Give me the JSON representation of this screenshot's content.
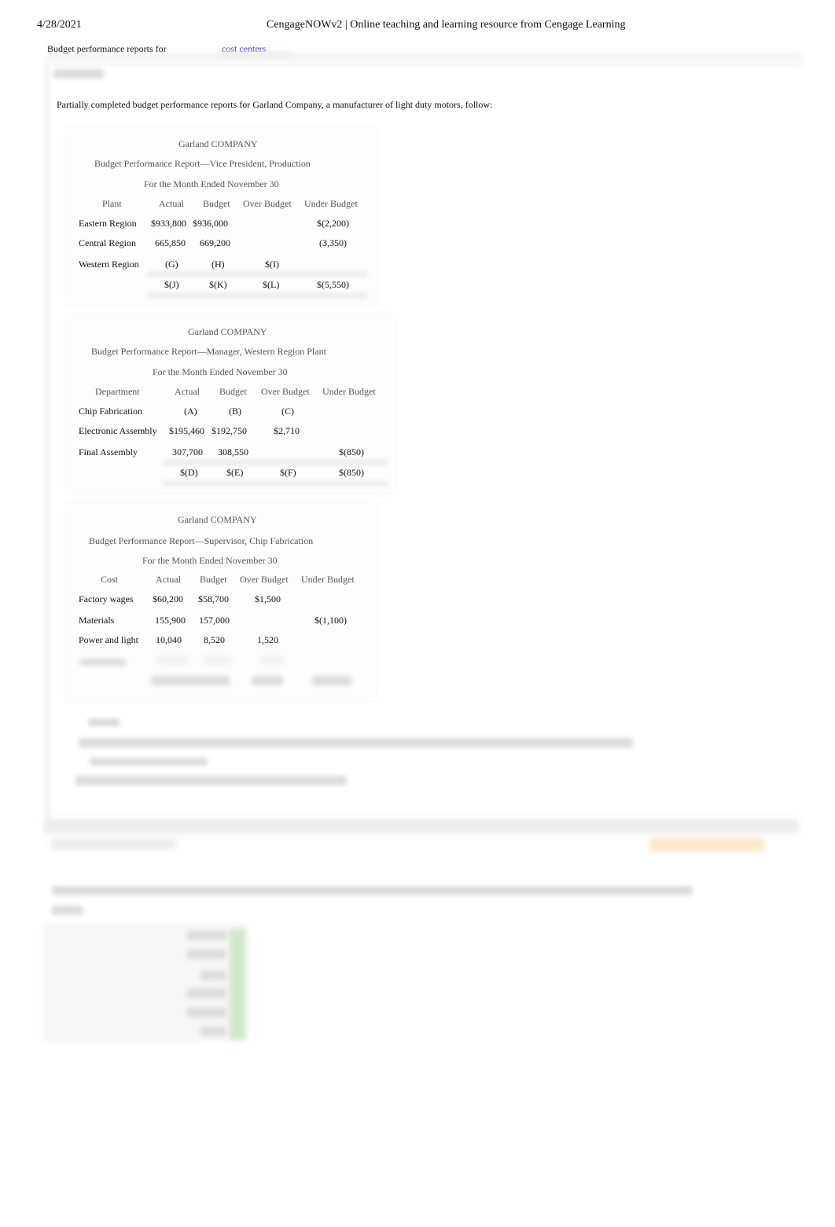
{
  "page_header": {
    "date": "4/28/2021",
    "title": "CengageNOWv2 | Online teaching and learning resource from Cengage Learning"
  },
  "topic": {
    "label": "Budget performance reports for",
    "link": "cost centers"
  },
  "intro": "Partially completed budget performance reports for Garland Company, a manufacturer of light duty motors, follow:",
  "reports": [
    {
      "company": "Garland COMPANY",
      "title": "Budget Performance Report—Vice President, Production",
      "period": "For the Month Ended November 30",
      "headers": [
        "Plant",
        "Actual",
        "Budget",
        "Over Budget",
        "Under Budget"
      ],
      "rows": [
        [
          "Eastern Region",
          "$933,800",
          "$936,000",
          "",
          "$(2,200)"
        ],
        [
          "Central Region",
          "665,850",
          "669,200",
          "",
          "(3,350)"
        ],
        [
          "Western Region",
          "(G)",
          "(H)",
          "$(I)",
          ""
        ],
        [
          "",
          "$(J)",
          "$(K)",
          "$(L)",
          "$(5,550)"
        ]
      ]
    },
    {
      "company": "Garland COMPANY",
      "title": "Budget Performance Report—Manager, Western Region Plant",
      "period": "For the Month Ended November 30",
      "headers": [
        "Department",
        "Actual",
        "Budget",
        "Over Budget",
        "Under Budget"
      ],
      "rows": [
        [
          "Chip Fabrication",
          "(A)",
          "(B)",
          "(C)",
          ""
        ],
        [
          "Electronic Assembly",
          "$195,460",
          "$192,750",
          "$2,710",
          ""
        ],
        [
          "Final Assembly",
          "307,700",
          "308,550",
          "",
          "$(850)"
        ],
        [
          "",
          "$(D)",
          "$(E)",
          "$(F)",
          "$(850)"
        ]
      ]
    },
    {
      "company": "Garland COMPANY",
      "title": "Budget Performance Report—Supervisor, Chip Fabrication",
      "period": "For the Month Ended November 30",
      "headers": [
        "Cost",
        "Actual",
        "Budget",
        "Over Budget",
        "Under Budget"
      ],
      "rows": [
        [
          "Factory wages",
          "$60,200",
          "$58,700",
          "$1,500",
          ""
        ],
        [
          "Materials",
          "155,900",
          "157,000",
          "",
          "$(1,100)"
        ],
        [
          "Power and light",
          "10,040",
          "8,520",
          "1,520",
          ""
        ]
      ]
    }
  ]
}
